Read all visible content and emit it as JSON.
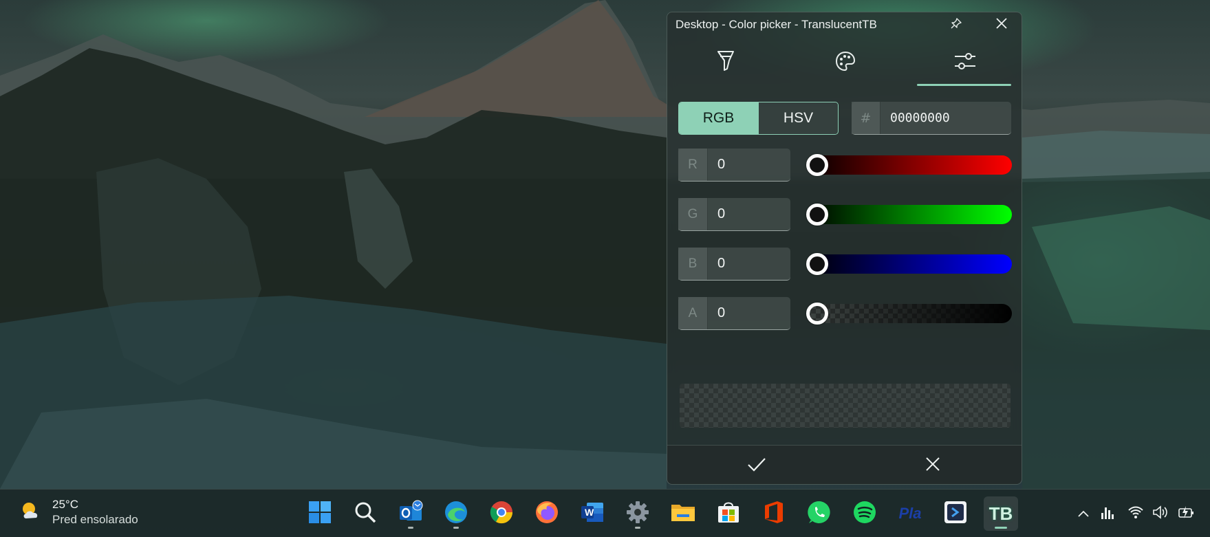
{
  "window": {
    "title": "Desktop - Color picker - TranslucentTB",
    "tabs": [
      {
        "icon": "marker-icon"
      },
      {
        "icon": "palette-icon"
      },
      {
        "icon": "sliders-icon",
        "selected": true
      }
    ],
    "mode": {
      "options": [
        "RGB",
        "HSV"
      ],
      "selected": "RGB"
    },
    "hex": {
      "prefix": "#",
      "value": "00000000"
    },
    "channels": [
      {
        "letter": "R",
        "value": "0",
        "fraction": 0
      },
      {
        "letter": "G",
        "value": "0",
        "fraction": 0
      },
      {
        "letter": "B",
        "value": "0",
        "fraction": 0
      },
      {
        "letter": "A",
        "value": "0",
        "fraction": 0
      }
    ],
    "accent": "#8ed1b6"
  },
  "taskbar": {
    "weather": {
      "temp": "25°C",
      "condition": "Pred ensolarado"
    },
    "apps": [
      {
        "name": "start"
      },
      {
        "name": "search"
      },
      {
        "name": "outlook",
        "running": true
      },
      {
        "name": "edge",
        "running": true
      },
      {
        "name": "chrome"
      },
      {
        "name": "firefox"
      },
      {
        "name": "word"
      },
      {
        "name": "settings",
        "running": true
      },
      {
        "name": "file-explorer"
      },
      {
        "name": "microsoft-store"
      },
      {
        "name": "office"
      },
      {
        "name": "whatsapp"
      },
      {
        "name": "spotify"
      },
      {
        "name": "pla"
      },
      {
        "name": "remote-desktop"
      },
      {
        "name": "translucenttb",
        "running": true,
        "active": true
      }
    ],
    "pla_label": "Pla",
    "tb_label": "TB",
    "word_label": "W"
  }
}
